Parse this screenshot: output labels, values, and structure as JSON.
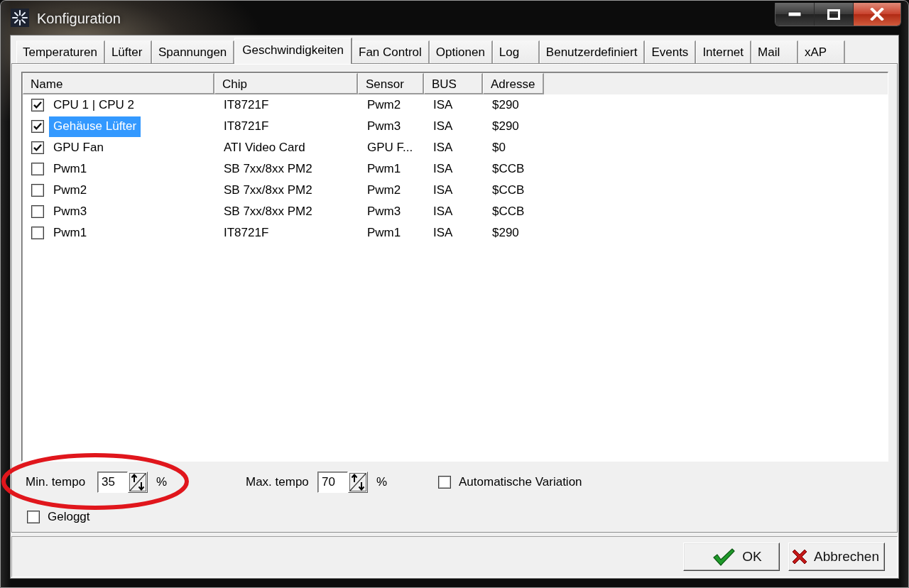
{
  "window": {
    "title": "Konfiguration"
  },
  "tabs": [
    {
      "label": "Temperaturen",
      "selected": false
    },
    {
      "label": "Lüfter",
      "selected": false
    },
    {
      "label": "Spannungen",
      "selected": false
    },
    {
      "label": "Geschwindigkeiten",
      "selected": true
    },
    {
      "label": "Fan Control",
      "selected": false
    },
    {
      "label": "Optionen",
      "selected": false
    },
    {
      "label": "Log",
      "selected": false
    },
    {
      "label": "Benutzerdefiniert",
      "selected": false
    },
    {
      "label": "Events",
      "selected": false
    },
    {
      "label": "Internet",
      "selected": false
    },
    {
      "label": "Mail",
      "selected": false
    },
    {
      "label": "xAP",
      "selected": false
    }
  ],
  "table": {
    "columns": [
      "Name",
      "Chip",
      "Sensor",
      "BUS",
      "Adresse"
    ],
    "rows": [
      {
        "checked": true,
        "selected": false,
        "cells": [
          "CPU 1 | CPU 2",
          "IT8721F",
          "Pwm2",
          "ISA",
          "$290"
        ]
      },
      {
        "checked": true,
        "selected": true,
        "cells": [
          "Gehäuse Lüfter",
          "IT8721F",
          "Pwm3",
          "ISA",
          "$290"
        ]
      },
      {
        "checked": true,
        "selected": false,
        "cells": [
          "GPU Fan",
          "ATI Video Card",
          "GPU F...",
          "ISA",
          "$0"
        ]
      },
      {
        "checked": false,
        "selected": false,
        "cells": [
          "Pwm1",
          "SB 7xx/8xx PM2",
          "Pwm1",
          "ISA",
          "$CCB"
        ]
      },
      {
        "checked": false,
        "selected": false,
        "cells": [
          "Pwm2",
          "SB 7xx/8xx PM2",
          "Pwm2",
          "ISA",
          "$CCB"
        ]
      },
      {
        "checked": false,
        "selected": false,
        "cells": [
          "Pwm3",
          "SB 7xx/8xx PM2",
          "Pwm3",
          "ISA",
          "$CCB"
        ]
      },
      {
        "checked": false,
        "selected": false,
        "cells": [
          "Pwm1",
          "IT8721F",
          "Pwm1",
          "ISA",
          "$290"
        ]
      }
    ]
  },
  "settings": {
    "min_tempo": {
      "label": "Min. tempo",
      "value": "35",
      "unit": "%"
    },
    "max_tempo": {
      "label": "Max. tempo",
      "value": "70",
      "unit": "%"
    },
    "auto_variation": {
      "label": "Automatische Variation",
      "checked": false
    },
    "logged": {
      "label": "Geloggt",
      "checked": false
    }
  },
  "annotation": {
    "kind": "ellipse"
  },
  "buttons": [
    {
      "label": "OK",
      "kind": "ok"
    },
    {
      "label": "Abbrechen",
      "kind": "cancel"
    }
  ]
}
